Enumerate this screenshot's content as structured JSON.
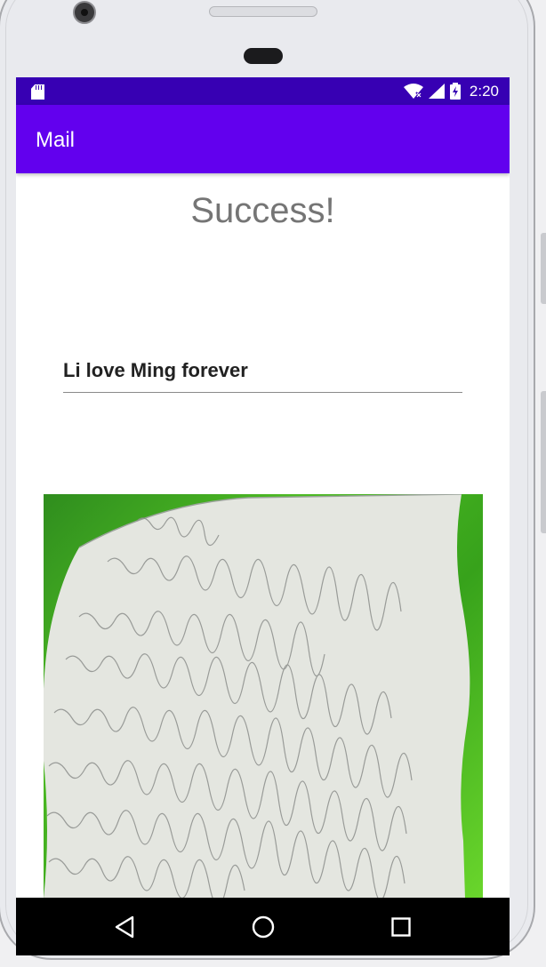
{
  "status_bar": {
    "time": "2:20",
    "icons": [
      "sd-card-icon",
      "wifi-icon",
      "signal-icon",
      "battery-charging-icon"
    ]
  },
  "app_bar": {
    "title": "Mail"
  },
  "main": {
    "heading": "Success!",
    "message_value": "Li love Ming forever"
  },
  "colors": {
    "status_bar": "#3700b3",
    "app_bar": "#6200ee",
    "heading_text": "#757575"
  },
  "nav_bar": {
    "buttons": [
      "back-icon",
      "home-icon",
      "recents-icon"
    ]
  }
}
